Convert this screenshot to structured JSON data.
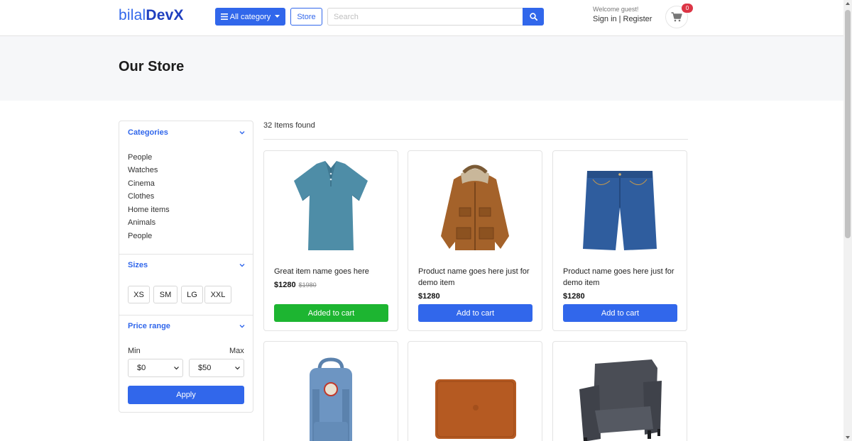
{
  "colors": {
    "primary": "#3167eb",
    "success": "#1db531",
    "danger": "#dc3545"
  },
  "header": {
    "logo_a": "bilal",
    "logo_b": "DevX",
    "category_button": "All category",
    "store_button": "Store",
    "search_placeholder": "Search",
    "welcome": "Welcome guest!",
    "sign_in": "Sign in",
    "separator": "|",
    "register": "Register",
    "cart_count": "0",
    "icons": {
      "menu": "bars-icon",
      "search": "search-icon",
      "cart": "cart-icon"
    }
  },
  "banner": {
    "title": "Our Store"
  },
  "sidebar": {
    "categories": {
      "title": "Categories",
      "items": [
        "People",
        "Watches",
        "Cinema",
        "Clothes",
        "Home items",
        "Animals",
        "People"
      ]
    },
    "sizes": {
      "title": "Sizes",
      "items": [
        "XS",
        "SM",
        "LG",
        "XXL"
      ]
    },
    "price": {
      "title": "Price range",
      "min_label": "Min",
      "max_label": "Max",
      "min_value": "$0",
      "max_value": "$50",
      "apply": "Apply"
    }
  },
  "content": {
    "count": "32 Items found",
    "products": [
      {
        "name": "Great item name goes here",
        "price": "$1280",
        "old_price": "$1980",
        "cta": "Added to cart",
        "image": "polo-shirt"
      },
      {
        "name": "Product name goes here just for demo item",
        "price": "$1280",
        "old_price": "",
        "cta": "Add to cart",
        "image": "jacket"
      },
      {
        "name": "Product name goes here just for demo item",
        "price": "$1280",
        "old_price": "",
        "cta": "Add to cart",
        "image": "denim-shorts"
      },
      {
        "image": "backpack"
      },
      {
        "image": "laptop-sleeve"
      },
      {
        "image": "armchair"
      }
    ]
  }
}
